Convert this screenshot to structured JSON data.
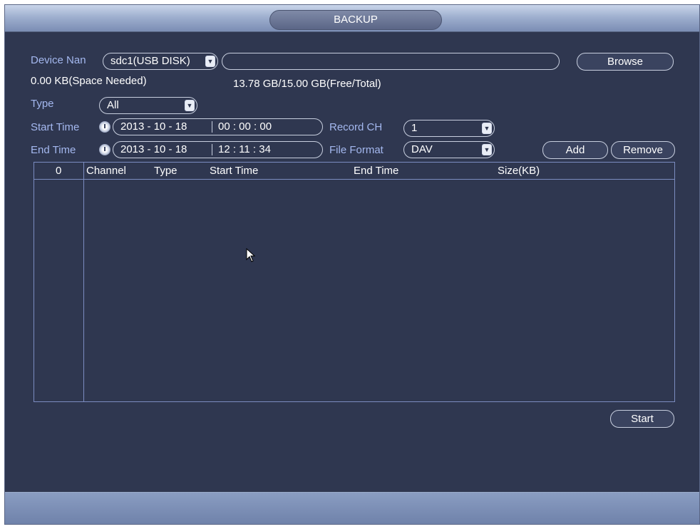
{
  "window": {
    "title": "BACKUP"
  },
  "device": {
    "label": "Device Nan",
    "selected": "sdc1(USB DISK)",
    "path_value": "",
    "browse_label": "Browse"
  },
  "space": {
    "needed": "0.00 KB(Space Needed)",
    "free_total": "13.78 GB/15.00 GB(Free/Total)"
  },
  "type": {
    "label": "Type",
    "selected": "All"
  },
  "start_time": {
    "label": "Start Time",
    "date": "2013 - 10 - 18",
    "time": "00 : 00 : 00"
  },
  "end_time": {
    "label": "End Time",
    "date": "2013 - 10 - 18",
    "time": "12 : 11 : 34"
  },
  "record_ch": {
    "label": "Record CH",
    "selected": "1"
  },
  "file_format": {
    "label": "File Format",
    "selected": "DAV"
  },
  "buttons": {
    "add": "Add",
    "remove": "Remove",
    "start": "Start"
  },
  "table": {
    "count": "0",
    "columns": [
      "Channel",
      "Type",
      "Start Time",
      "End Time",
      "Size(KB)"
    ],
    "rows": []
  },
  "colors": {
    "background": "#2f3750",
    "label_blue": "#a4b8ef",
    "title_bar": "#9fb0cf"
  }
}
